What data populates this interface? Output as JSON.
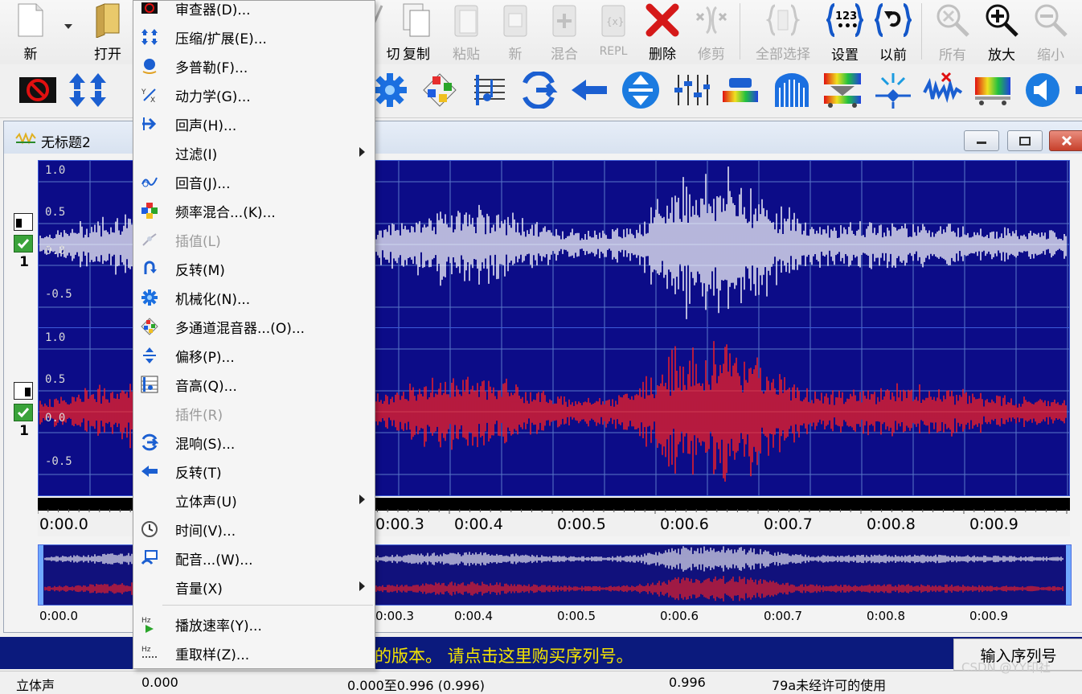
{
  "toolbar": {
    "buttons": [
      {
        "id": "new",
        "label": "新",
        "enabled": true,
        "icon": "document-icon"
      },
      {
        "id": "open",
        "label": "打开",
        "enabled": true,
        "icon": "folder-open-icon"
      },
      {
        "id": "cut",
        "label": "切",
        "enabled": true,
        "icon": "scissors-icon"
      },
      {
        "id": "copy",
        "label": "复制",
        "enabled": true,
        "icon": "copy-icon"
      },
      {
        "id": "paste",
        "label": "粘贴",
        "enabled": false,
        "icon": "paste-icon"
      },
      {
        "id": "paste-new",
        "label": "新",
        "enabled": false,
        "icon": "paste-new-icon"
      },
      {
        "id": "mix",
        "label": "混合",
        "enabled": false,
        "icon": "mix-paste-icon"
      },
      {
        "id": "repl",
        "label": "REPL",
        "enabled": false,
        "icon": "replace-icon"
      },
      {
        "id": "delete",
        "label": "删除",
        "enabled": true,
        "icon": "delete-x-icon"
      },
      {
        "id": "trim",
        "label": "修剪",
        "enabled": false,
        "icon": "trim-icon"
      },
      {
        "id": "select-all",
        "label": "全部选择",
        "enabled": false,
        "icon": "select-all-icon"
      },
      {
        "id": "settings",
        "label": "设置",
        "enabled": true,
        "icon": "settings-123-icon"
      },
      {
        "id": "undo",
        "label": "以前",
        "enabled": true,
        "icon": "undo-icon"
      },
      {
        "id": "zoom-all",
        "label": "所有",
        "enabled": false,
        "icon": "zoom-all-icon"
      },
      {
        "id": "zoom-in",
        "label": "放大",
        "enabled": true,
        "icon": "zoom-in-icon"
      },
      {
        "id": "zoom-out",
        "label": "缩小",
        "enabled": false,
        "icon": "zoom-out-icon"
      }
    ]
  },
  "document": {
    "title": "无标题2",
    "channels": [
      {
        "number": "1",
        "color": "#ffffff"
      },
      {
        "number": "1",
        "color": "#ff2020"
      }
    ],
    "amplitude_labels": [
      "1.0",
      "0.5",
      "0.0",
      "-0.5"
    ],
    "time_labels": [
      "0:00.0",
      "0:00.3",
      "0:00.4",
      "0:00.5",
      "0:00.6",
      "0:00.7",
      "0:00.8",
      "0:00.9"
    ],
    "overview_time_labels": [
      "0:00.0",
      "0:00.3",
      "0:00.4",
      "0:00.5",
      "0:00.6",
      "0:00.7",
      "0:00.8",
      "0:00.9"
    ]
  },
  "menu": {
    "items": [
      {
        "label": "审查器(D)...",
        "icon": "stop-icon",
        "enabled": true,
        "submenu": false
      },
      {
        "label": "压缩/扩展(E)...",
        "icon": "compress-icon",
        "enabled": true,
        "submenu": false
      },
      {
        "label": "多普勒(F)...",
        "icon": "doppler-icon",
        "enabled": true,
        "submenu": false
      },
      {
        "label": "动力学(G)...",
        "icon": "dynamics-icon",
        "enabled": true,
        "submenu": false
      },
      {
        "label": "回声(H)...",
        "icon": "echo-icon",
        "enabled": true,
        "submenu": false
      },
      {
        "label": "过滤(I)",
        "icon": "",
        "enabled": true,
        "submenu": true
      },
      {
        "label": "回音(J)...",
        "icon": "reverb-icon",
        "enabled": true,
        "submenu": false
      },
      {
        "label": "频率混合...(K)...",
        "icon": "frequency-mix-icon",
        "enabled": true,
        "submenu": false
      },
      {
        "label": "插值(L)",
        "icon": "interpolate-icon",
        "enabled": false,
        "submenu": false
      },
      {
        "label": "反转(M)",
        "icon": "invert-icon",
        "enabled": true,
        "submenu": false
      },
      {
        "label": "机械化(N)...",
        "icon": "gear-icon",
        "enabled": true,
        "submenu": false
      },
      {
        "label": "多通道混音器...(O)...",
        "icon": "multichannel-mixer-icon",
        "enabled": true,
        "submenu": false
      },
      {
        "label": "偏移(P)...",
        "icon": "offset-icon",
        "enabled": true,
        "submenu": false
      },
      {
        "label": "音高(Q)...",
        "icon": "pitch-icon",
        "enabled": true,
        "submenu": false
      },
      {
        "label": "插件(R)",
        "icon": "",
        "enabled": false,
        "submenu": false
      },
      {
        "label": "混响(S)...",
        "icon": "reverb-arrow-icon",
        "enabled": true,
        "submenu": false
      },
      {
        "label": "反转(T)",
        "icon": "reverse-icon",
        "enabled": true,
        "submenu": false
      },
      {
        "label": "立体声(U)",
        "icon": "",
        "enabled": true,
        "submenu": true
      },
      {
        "label": "时间(V)...",
        "icon": "clock-icon",
        "enabled": true,
        "submenu": false
      },
      {
        "label": "配音...(W)...",
        "icon": "voiceover-icon",
        "enabled": true,
        "submenu": false
      },
      {
        "label": "音量(X)",
        "icon": "",
        "enabled": true,
        "submenu": true
      },
      {
        "label": "播放速率(Y)...",
        "icon": "playback-rate-icon",
        "enabled": true,
        "submenu": false
      },
      {
        "label": "重取样(Z)...",
        "icon": "resample-icon",
        "enabled": true,
        "submenu": false
      }
    ]
  },
  "nag": {
    "text": "的版本。 请点击这里购买序列号。",
    "button": "输入序列号"
  },
  "statusbar": {
    "mode": "立体声",
    "pos1": "0.000",
    "selection": "0.000至0.996 (0.996)",
    "pos2": "0.996",
    "license": "79a未经许可的使用"
  },
  "watermark": "CSDN @YY印社"
}
